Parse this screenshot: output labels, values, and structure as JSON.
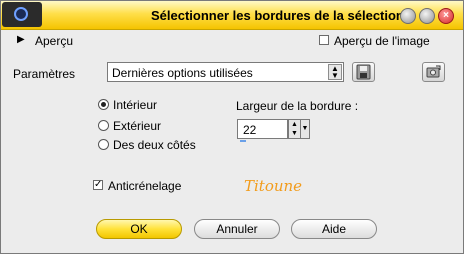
{
  "window": {
    "title": "Sélectionner les bordures de la sélection",
    "buttons": [
      "minimize",
      "maximize",
      "close"
    ]
  },
  "preview": {
    "toggle_label": "Aperçu",
    "image_preview_label": "Aperçu de l'image",
    "image_preview_checked": false
  },
  "parameters": {
    "label": "Paramètres",
    "preset_value": "Dernières options utilisées"
  },
  "border_side": {
    "options": [
      {
        "label": "Intérieur",
        "selected": true
      },
      {
        "label": "Extérieur",
        "selected": false
      },
      {
        "label": "Des deux côtés",
        "selected": false
      }
    ]
  },
  "border_width": {
    "label": "Largeur de la bordure :",
    "value": "22"
  },
  "antialias": {
    "label": "Anticrénelage",
    "checked": true
  },
  "signature": "Titoune",
  "actions": {
    "ok": "OK",
    "cancel": "Annuler",
    "help": "Aide"
  },
  "colors": {
    "titlebar": "#ffdf4a",
    "primary_button": "#ffe23a",
    "signature": "#f29c1c"
  }
}
